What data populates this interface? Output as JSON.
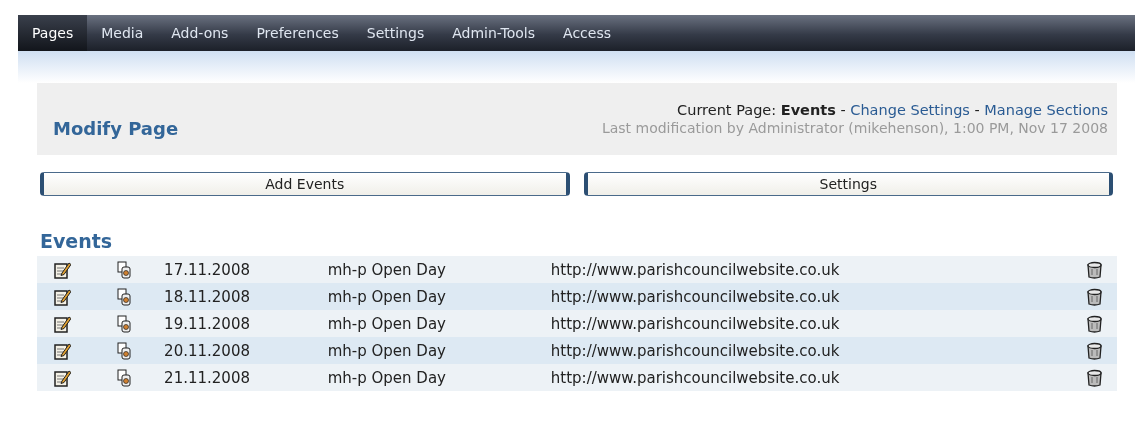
{
  "nav": [
    {
      "label": "Pages",
      "selected": true
    },
    {
      "label": "Media",
      "selected": false
    },
    {
      "label": "Add-ons",
      "selected": false
    },
    {
      "label": "Preferences",
      "selected": false
    },
    {
      "label": "Settings",
      "selected": false
    },
    {
      "label": "Admin-Tools",
      "selected": false
    },
    {
      "label": "Access",
      "selected": false
    }
  ],
  "header": {
    "title": "Modify Page",
    "current_label": "Current Page:",
    "current_page": "Events",
    "separator_1": "-",
    "link_1": "Change Settings",
    "separator_2": "-",
    "link_2": "Manage Sections",
    "last_modified": "Last modification by Administrator (mikehenson), 1:00 PM, Nov 17 2008"
  },
  "buttons": [
    "Add Events",
    "Settings"
  ],
  "section_title": "Events",
  "rows": [
    {
      "date": "17.11.2008",
      "name": "mh-p Open Day",
      "url": "http://www.parishcouncilwebsite.co.uk"
    },
    {
      "date": "18.11.2008",
      "name": "mh-p Open Day",
      "url": "http://www.parishcouncilwebsite.co.uk"
    },
    {
      "date": "19.11.2008",
      "name": "mh-p Open Day",
      "url": "http://www.parishcouncilwebsite.co.uk"
    },
    {
      "date": "20.11.2008",
      "name": "mh-p Open Day",
      "url": "http://www.parishcouncilwebsite.co.uk"
    },
    {
      "date": "21.11.2008",
      "name": "mh-p Open Day",
      "url": "http://www.parishcouncilwebsite.co.uk"
    }
  ]
}
